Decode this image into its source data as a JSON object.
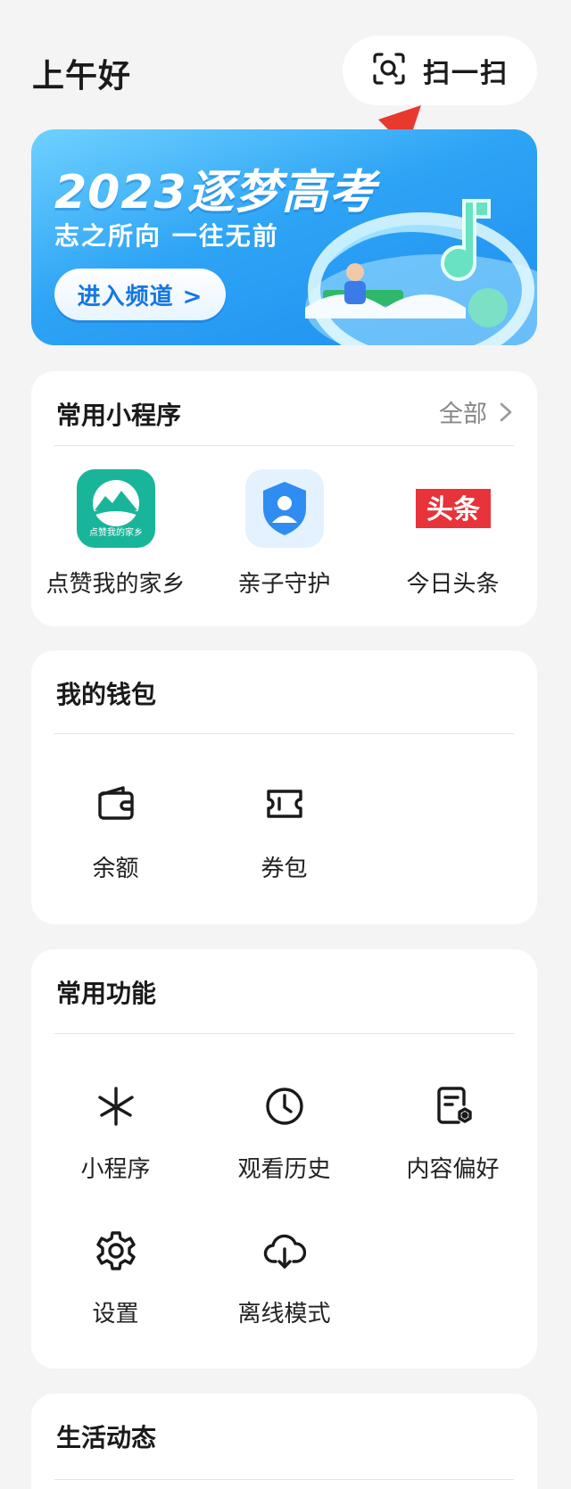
{
  "header": {
    "greeting": "上午好",
    "scan_label": "扫一扫",
    "scan_icon": "scan-icon"
  },
  "banner": {
    "title": "2023逐梦高考",
    "subtitle": "志之所向 一往无前",
    "button_label": "进入频道 >"
  },
  "mini_programs": {
    "title": "常用小程序",
    "more_label": "全部",
    "items": [
      {
        "label": "点赞我的家乡",
        "icon": "hometown-app-icon",
        "icon_text": "点赞我的家乡",
        "color": "#19b59a"
      },
      {
        "label": "亲子守护",
        "icon": "parent-guard-app-icon",
        "color": "#2f8cf0"
      },
      {
        "label": "今日头条",
        "icon": "toutiao-app-icon",
        "icon_text": "头条",
        "color": "#e8333a"
      }
    ]
  },
  "wallet": {
    "title": "我的钱包",
    "items": [
      {
        "label": "余额",
        "icon": "wallet-icon"
      },
      {
        "label": "券包",
        "icon": "coupon-icon"
      }
    ]
  },
  "features": {
    "title": "常用功能",
    "items": [
      {
        "label": "小程序",
        "icon": "mini-program-icon"
      },
      {
        "label": "观看历史",
        "icon": "clock-icon"
      },
      {
        "label": "内容偏好",
        "icon": "content-preference-icon"
      },
      {
        "label": "设置",
        "icon": "gear-icon"
      },
      {
        "label": "离线模式",
        "icon": "cloud-download-icon"
      }
    ]
  },
  "life": {
    "title": "生活动态"
  },
  "colors": {
    "background": "#f4f4f5",
    "card": "#ffffff",
    "accent_blue": "#1d8ff0",
    "arrow_red": "#e8392e"
  }
}
